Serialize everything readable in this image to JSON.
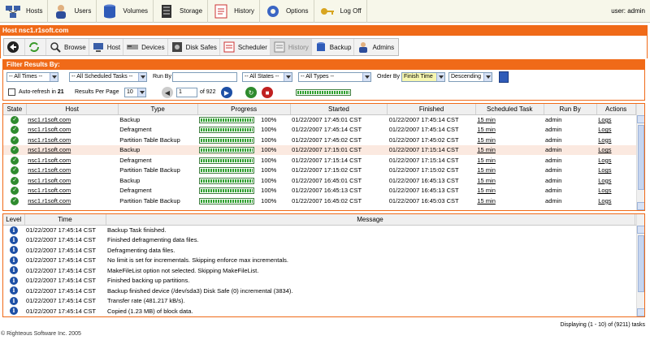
{
  "nav": {
    "hosts": "Hosts",
    "users": "Users",
    "volumes": "Volumes",
    "storage": "Storage",
    "history": "History",
    "options": "Options",
    "logoff": "Log Off",
    "user_label": "user: admin"
  },
  "host_title": "Host nsc1.r1soft.com",
  "toolbar": {
    "browse": "Browse",
    "host": "Host",
    "devices": "Devices",
    "disk_safes": "Disk Safes",
    "scheduler": "Scheduler",
    "history": "History",
    "backup": "Backup",
    "admins": "Admins"
  },
  "filter": {
    "title": "Filter Results By:",
    "times": "-- All Times --",
    "scheduled": "-- All Scheduled Tasks --",
    "run_by_label": "Run By",
    "run_by_value": "",
    "states": "-- All States --",
    "types": "-- All Types --",
    "order_by_label": "Order By",
    "order_by": "Finish Time",
    "direction": "Descending",
    "auto_refresh": "Auto-refresh in",
    "auto_refresh_count": "21",
    "results_per_page_label": "Results Per Page",
    "results_per_page": "10",
    "page": "1",
    "page_of": "of 922"
  },
  "tasks": {
    "headers": [
      "State",
      "Host",
      "Type",
      "Progress",
      "Started",
      "Finished",
      "Scheduled Task",
      "Run By",
      "Actions"
    ],
    "rows": [
      {
        "host": "nsc1.r1soft.com",
        "type": "Backup",
        "progress": 100,
        "pct": "100%",
        "started": "01/22/2007 17:45:01 CST",
        "finished": "01/22/2007 17:45:14 CST",
        "sched": "15 min",
        "run_by": "admin",
        "action": "Logs"
      },
      {
        "host": "nsc1.r1soft.com",
        "type": "Defragment",
        "progress": 100,
        "pct": "100%",
        "started": "01/22/2007 17:45:14 CST",
        "finished": "01/22/2007 17:45:14 CST",
        "sched": "15 min",
        "run_by": "admin",
        "action": "Logs"
      },
      {
        "host": "nsc1.r1soft.com",
        "type": "Partition Table Backup",
        "progress": 100,
        "pct": "100%",
        "started": "01/22/2007 17:45:02 CST",
        "finished": "01/22/2007 17:45:02 CST",
        "sched": "15 min",
        "run_by": "admin",
        "action": "Logs"
      },
      {
        "host": "nsc1.r1soft.com",
        "type": "Backup",
        "progress": 100,
        "pct": "100%",
        "started": "01/22/2007 17:15:01 CST",
        "finished": "01/22/2007 17:15:14 CST",
        "sched": "15 min",
        "run_by": "admin",
        "action": "Logs"
      },
      {
        "host": "nsc1.r1soft.com",
        "type": "Defragment",
        "progress": 100,
        "pct": "100%",
        "started": "01/22/2007 17:15:14 CST",
        "finished": "01/22/2007 17:15:14 CST",
        "sched": "15 min",
        "run_by": "admin",
        "action": "Logs"
      },
      {
        "host": "nsc1.r1soft.com",
        "type": "Partition Table Backup",
        "progress": 100,
        "pct": "100%",
        "started": "01/22/2007 17:15:02 CST",
        "finished": "01/22/2007 17:15:02 CST",
        "sched": "15 min",
        "run_by": "admin",
        "action": "Logs"
      },
      {
        "host": "nsc1.r1soft.com",
        "type": "Backup",
        "progress": 100,
        "pct": "100%",
        "started": "01/22/2007 16:45:01 CST",
        "finished": "01/22/2007 16:45:13 CST",
        "sched": "15 min",
        "run_by": "admin",
        "action": "Logs"
      },
      {
        "host": "nsc1.r1soft.com",
        "type": "Defragment",
        "progress": 100,
        "pct": "100%",
        "started": "01/22/2007 16:45:13 CST",
        "finished": "01/22/2007 16:45:13 CST",
        "sched": "15 min",
        "run_by": "admin",
        "action": "Logs"
      },
      {
        "host": "nsc1.r1soft.com",
        "type": "Partition Table Backup",
        "progress": 100,
        "pct": "100%",
        "started": "01/22/2007 16:45:02 CST",
        "finished": "01/22/2007 16:45:03 CST",
        "sched": "15 min",
        "run_by": "admin",
        "action": "Logs"
      }
    ]
  },
  "logs": {
    "headers": [
      "Level",
      "Time",
      "Message"
    ],
    "rows": [
      {
        "time": "01/22/2007 17:45:14 CST",
        "msg": "Backup Task finished."
      },
      {
        "time": "01/22/2007 17:45:14 CST",
        "msg": "Finished defragmenting data files."
      },
      {
        "time": "01/22/2007 17:45:14 CST",
        "msg": "Defragmenting data files."
      },
      {
        "time": "01/22/2007 17:45:14 CST",
        "msg": "No limit is set for incrementals. Skipping enforce max incrementals."
      },
      {
        "time": "01/22/2007 17:45:14 CST",
        "msg": "MakeFileList option not selected. Skipping MakeFileList."
      },
      {
        "time": "01/22/2007 17:45:14 CST",
        "msg": "Finished backing up partitions."
      },
      {
        "time": "01/22/2007 17:45:14 CST",
        "msg": "Backup finished device (/dev/sda3) Disk Safe (0) incremental (3834)."
      },
      {
        "time": "01/22/2007 17:45:14 CST",
        "msg": "Transfer rate (481.217 kB/s)."
      },
      {
        "time": "01/22/2007 17:45:14 CST",
        "msg": "Copied (1.23 MB) of block data."
      }
    ]
  },
  "displaying": "Displaying (1 - 10) of (9211) tasks",
  "footer": "© Righteous Software Inc. 2005",
  "colors": {
    "accent": "#f06a18",
    "ok": "#2e8b2e",
    "info": "#1d4fa5"
  }
}
